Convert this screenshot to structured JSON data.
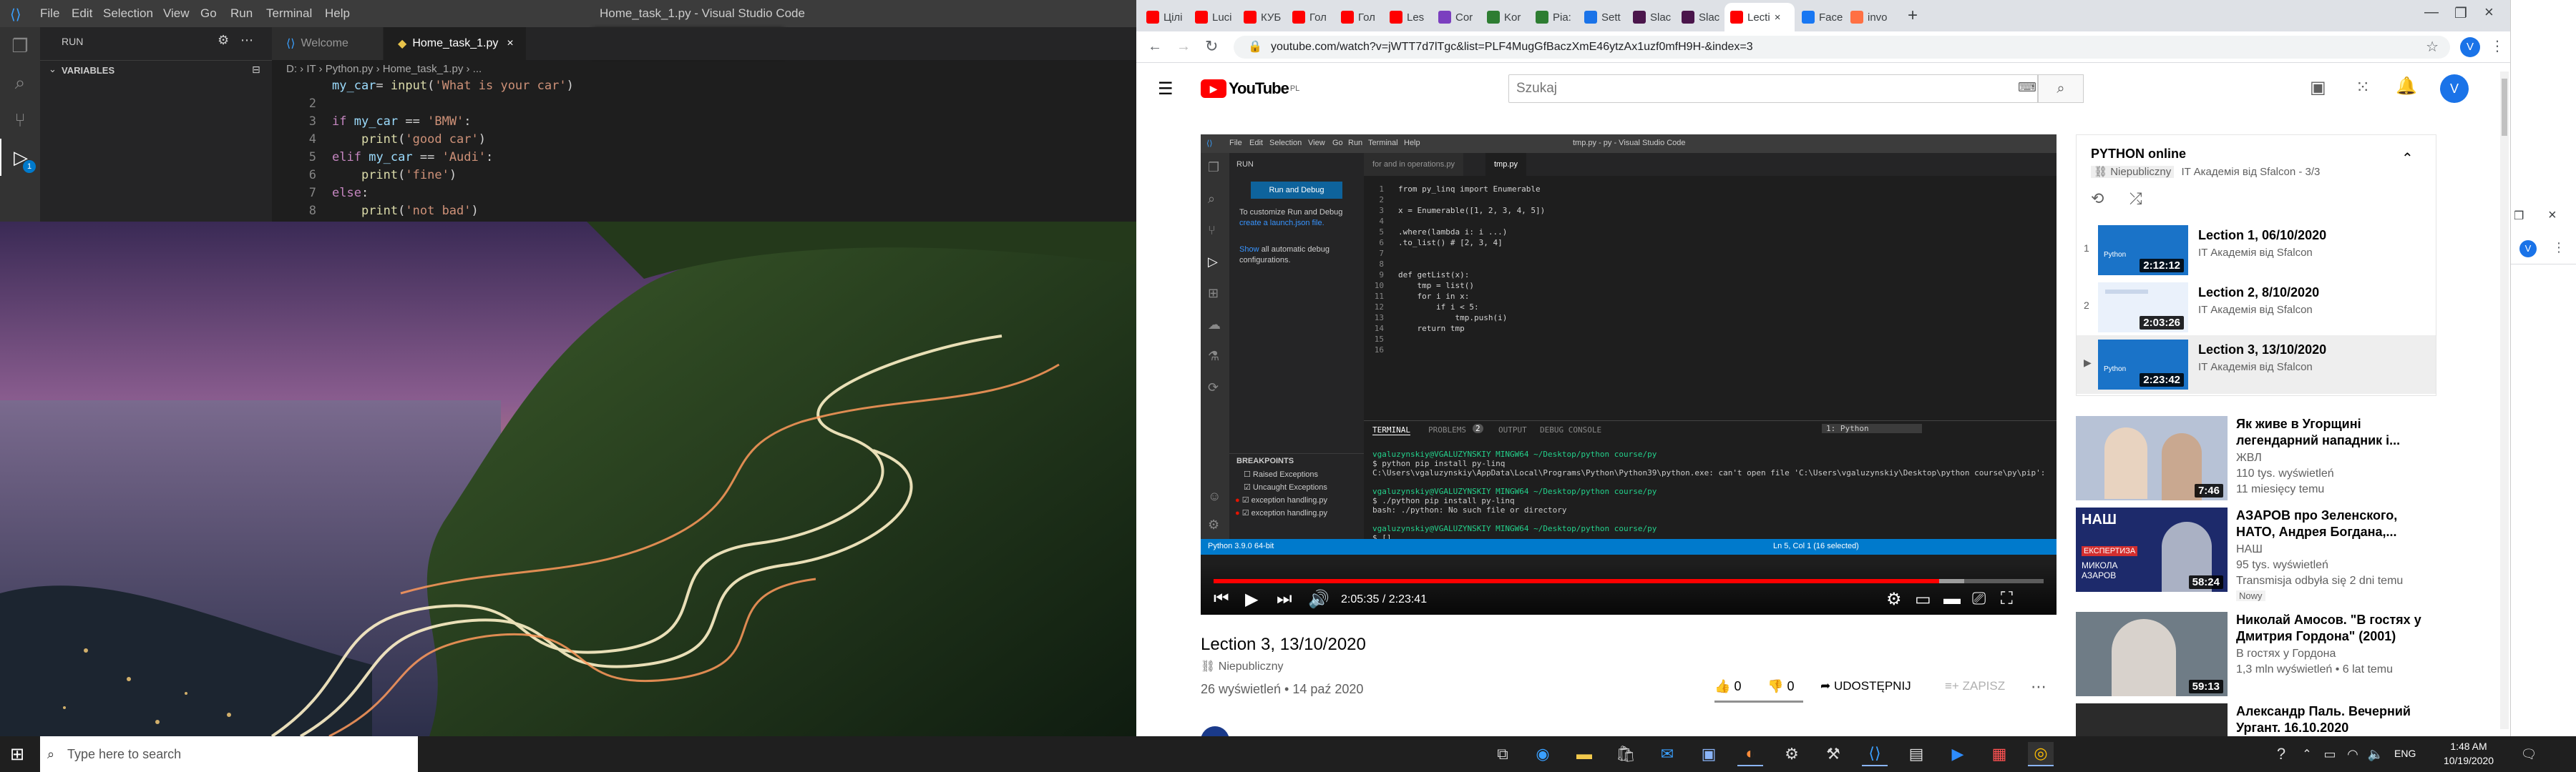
{
  "vscode": {
    "menu": [
      "File",
      "Edit",
      "Selection",
      "View",
      "Go",
      "Run",
      "Terminal",
      "Help"
    ],
    "window_title": "Home_task_1.py - Visual Studio Code",
    "sidebar_header": "RUN",
    "variables_label": "VARIABLES",
    "tabs": [
      "Welcome",
      "Home_task_1.py"
    ],
    "breadcrumb": "D: › IT › Python.py › Home_task_1.py › ...",
    "code_lines": [
      {
        "n": "",
        "t": "my_car= input('What is your car')"
      },
      {
        "n": "2",
        "t": ""
      },
      {
        "n": "3",
        "t": "if my_car == 'BMW':"
      },
      {
        "n": "4",
        "t": "    print('good car')"
      },
      {
        "n": "5",
        "t": "elif my_car == 'Audi':"
      },
      {
        "n": "6",
        "t": "    print('fine')"
      },
      {
        "n": "7",
        "t": "else:"
      },
      {
        "n": "8",
        "t": "    print('not bad')"
      }
    ],
    "badge_count": "1"
  },
  "chrome": {
    "tabs": [
      {
        "label": "Цілі",
        "color": "#ff0000"
      },
      {
        "label": "Lucі",
        "color": "#ff0000"
      },
      {
        "label": "КУБ",
        "color": "#ff0000"
      },
      {
        "label": "Гол",
        "color": "#ff0000"
      },
      {
        "label": "Гол",
        "color": "#ff0000"
      },
      {
        "label": "Les",
        "color": "#ff0000"
      },
      {
        "label": "Cor",
        "color": "#7b3fbf"
      },
      {
        "label": "Kor",
        "color": "#2e7d32"
      },
      {
        "label": "Pia:",
        "color": "#2e7d32"
      },
      {
        "label": "Sett",
        "color": "#1a73e8"
      },
      {
        "label": "Slac",
        "color": "#4a154b"
      },
      {
        "label": "Slac",
        "color": "#4a154b"
      },
      {
        "label": "Lecti",
        "color": "#ff0000"
      },
      {
        "label": "Face",
        "color": "#1877f2"
      },
      {
        "label": "invo",
        "color": "#ff7043"
      }
    ],
    "url": "youtube.com/watch?v=jWTT7d7lTgc&list=PLF4MugGfBaczXmE46ytzAx1uzf0mfH9H-&index=3"
  },
  "youtube": {
    "logo_text": "YouTube",
    "logo_sup": "PL",
    "search_placeholder": "Szukaj",
    "avatar_letter": "V",
    "player": {
      "time": "2:05:35 / 2:23:41",
      "progress_fraction": 0.874,
      "inner_title": "tmp.py - py - Visual Studio Code",
      "inner_menu": [
        "File",
        "Edit",
        "Selection",
        "View",
        "Go",
        "Run",
        "Terminal",
        "Help"
      ],
      "inner_sidebar_title": "RUN",
      "inner_run_button": "Run and Debug",
      "inner_sidebar_text1": "To customize Run and Debug",
      "inner_sidebar_link1": "create a launch.json file.",
      "inner_sidebar_link2": "Show",
      "inner_sidebar_text2": "all automatic debug configurations.",
      "inner_tabs": [
        "for and in operations.py",
        "tmp.py"
      ],
      "inner_code": [
        {
          "n": "1",
          "t": "from py_linq import Enumerable"
        },
        {
          "n": "2",
          "t": ""
        },
        {
          "n": "3",
          "t": "x = Enumerable([1, 2, 3, 4, 5])"
        },
        {
          "n": "4",
          "t": ""
        },
        {
          "n": "5",
          "t": ".where(lambda i: i ...)"
        },
        {
          "n": "6",
          "t": ".to_list() # [2, 3, 4]"
        },
        {
          "n": "7",
          "t": ""
        },
        {
          "n": "8",
          "t": ""
        },
        {
          "n": "9",
          "t": "def getList(x):"
        },
        {
          "n": "10",
          "t": "    tmp = list()"
        },
        {
          "n": "11",
          "t": "    for i in x:"
        },
        {
          "n": "12",
          "t": "        if i < 5:"
        },
        {
          "n": "13",
          "t": "            tmp.push(i)"
        },
        {
          "n": "14",
          "t": "    return tmp"
        },
        {
          "n": "15",
          "t": ""
        },
        {
          "n": "16",
          "t": ""
        }
      ],
      "terminal_tabs": [
        "TERMINAL",
        "PROBLEMS",
        "OUTPUT",
        "DEBUG CONSOLE"
      ],
      "terminal_problems_count": "2",
      "terminal_dropdown": "1: Python",
      "terminal_lines": [
        "vgaluzynskiy@VGALUZYNSKIY MINGW64 ~/Desktop/python course/py",
        "$ python pip install py-linq",
        "C:\\Users\\vgaluzynskiy\\AppData\\Local\\Programs\\Python\\Python39\\python.exe: can't open file 'C:\\Users\\vgaluzynskiy\\Desktop\\python course\\py\\pip': [Errno 2] No such file or directory",
        "",
        "vgaluzynskiy@VGALUZYNSKIY MINGW64 ~/Desktop/python course/py",
        "$ ./python pip install py-linq",
        "bash: ./python: No such file or directory",
        "",
        "vgaluzynskiy@VGALUZYNSKIY MINGW64 ~/Desktop/python course/py",
        "$ []"
      ],
      "breakpoints_title": "BREAKPOINTS",
      "breakpoints": [
        "Raised Exceptions",
        "Uncaught Exceptions",
        "exception handling.py",
        "exception handling.py"
      ],
      "status_left": "Python 3.9.0 64-bit",
      "status_right": "Ln 5, Col 1 (16 selected)"
    },
    "video": {
      "title": "Lection 3, 13/10/2020",
      "visibility": "Niepubliczny",
      "views_date": "26 wyświetleń • 14 paź 2020",
      "likes": "0",
      "dislikes": "0",
      "share": "UDOSTĘPNIJ",
      "save": "ZAPISZ"
    },
    "playlist": {
      "title": "PYTHON online",
      "visibility": "Niepubliczny",
      "channel_index": "IT Академія від Sfalcon - 3/3",
      "items": [
        {
          "idx": "1",
          "title": "Lection 1, 06/10/2020",
          "channel": "IT Академія від Sfalcon",
          "duration": "2:12:12",
          "current": false
        },
        {
          "idx": "2",
          "title": "Lection 2, 8/10/2020",
          "channel": "IT Академія від Sfalcon",
          "duration": "2:03:26",
          "current": false
        },
        {
          "idx": "▶",
          "title": "Lection 3, 13/10/2020",
          "channel": "IT Академія від Sfalcon",
          "duration": "2:23:42",
          "current": true
        }
      ]
    },
    "recommendations": [
      {
        "title": "Як живе в Угорщині легендарний нападник і...",
        "channel": "ЖВЛ",
        "meta1": "110 tys. wyświetleń",
        "meta2": "11 miesięcy temu",
        "duration": "7:46",
        "thumb_color": "#b7c2d6"
      },
      {
        "title": "АЗАРОВ про Зеленского, НАТО, Андрея Богдана,...",
        "channel": "НАШ",
        "meta1": "95 tys. wyświetleń",
        "meta2": "Transmisja odbyła się 2 dni temu",
        "badge": "Nowy",
        "duration": "58:24",
        "thumb_color": "#1d2a6b",
        "thumb_text1": "НАШ",
        "thumb_text2": "ЕКСПЕРТИЗА",
        "thumb_text3": "МИКОЛА АЗАРОВ"
      },
      {
        "title": "Николай Амосов. \"В гостях у Дмитрия Гордона\" (2001)",
        "channel": "В гостях у Гордона",
        "meta1": "1,3 mln wyświetleń • 6 lat temu",
        "duration": "59:13",
        "thumb_color": "#6f7c86"
      },
      {
        "title": "Александр Паль. Вечерний Ургант. 16.10.2020",
        "thumb_color": "#2b2b2b"
      }
    ]
  },
  "taskbar": {
    "search_placeholder": "Type here to search",
    "time": "1:48 AM",
    "date": "10/19/2020",
    "lang": "ENG"
  }
}
